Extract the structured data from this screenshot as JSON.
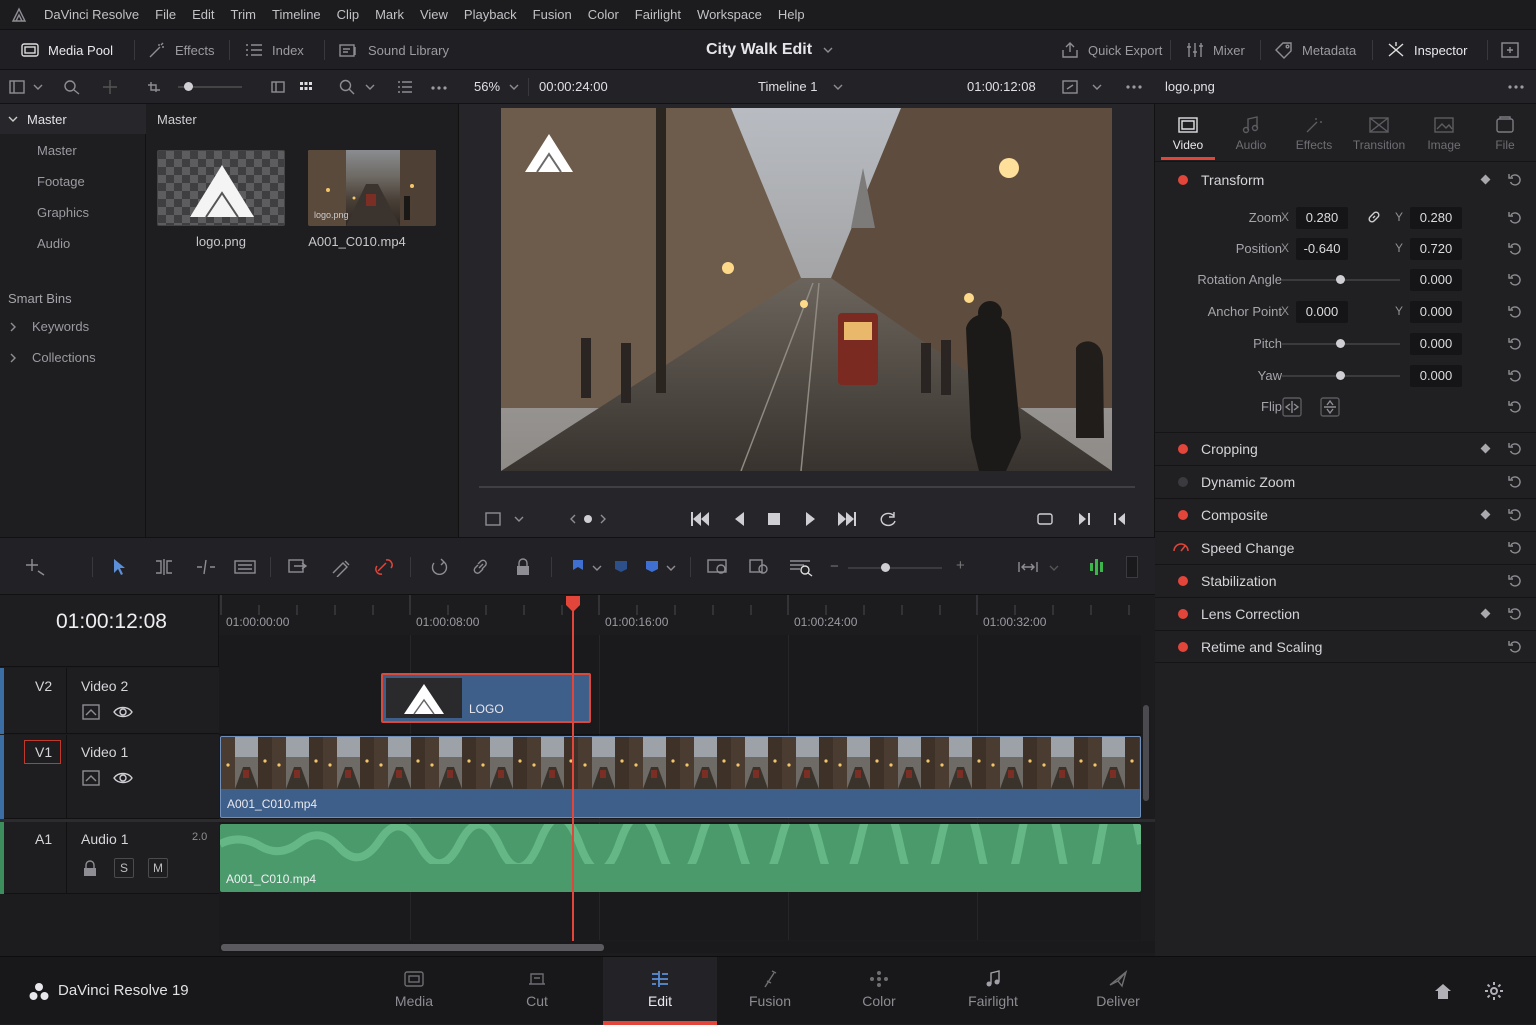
{
  "menubar": {
    "app_name": "DaVinci Resolve",
    "items": [
      "File",
      "Edit",
      "Trim",
      "Timeline",
      "Clip",
      "Mark",
      "View",
      "Playback",
      "Fusion",
      "Color",
      "Fairlight",
      "Workspace",
      "Help"
    ]
  },
  "toolbar": {
    "media_pool": "Media Pool",
    "effects": "Effects",
    "index": "Index",
    "sound_library": "Sound Library",
    "project_title": "City Walk Edit",
    "quick_export": "Quick Export",
    "mixer": "Mixer",
    "metadata": "Metadata",
    "inspector": "Inspector"
  },
  "media_pool": {
    "tree_root": "Master",
    "bins": [
      "Master",
      "Footage",
      "Graphics",
      "Audio"
    ],
    "smart_bins_label": "Smart Bins",
    "smart_bins": [
      "Keywords",
      "Collections"
    ],
    "panel_title": "Master",
    "clips": [
      {
        "name": "logo.png"
      },
      {
        "name": "A001_C010.mp4",
        "thumb_label": "logo.png"
      }
    ]
  },
  "viewer": {
    "zoom": "56%",
    "source_timecode": "00:00:24:00",
    "timeline_name": "Timeline 1",
    "current_timecode": "01:00:12:08"
  },
  "inspector": {
    "clip_name": "logo.png",
    "tabs": [
      "Video",
      "Audio",
      "Effects",
      "Transition",
      "Image",
      "File"
    ],
    "active_tab": "Video",
    "transform_title": "Transform",
    "zoom_label": "Zoom",
    "zoom_x": "0.280",
    "zoom_y": "0.280",
    "position_label": "Position",
    "position_x": "-0.640",
    "position_y": "0.720",
    "rotation_label": "Rotation Angle",
    "rotation": "0.000",
    "anchor_label": "Anchor Point",
    "anchor_x": "0.000",
    "anchor_y": "0.000",
    "pitch_label": "Pitch",
    "pitch": "0.000",
    "yaw_label": "Yaw",
    "yaw": "0.000",
    "flip_label": "Flip",
    "axis_x": "X",
    "axis_y": "Y",
    "sections": [
      "Cropping",
      "Dynamic Zoom",
      "Composite",
      "Speed Change",
      "Stabilization",
      "Lens Correction",
      "Retime and Scaling"
    ]
  },
  "timeline": {
    "timecode": "01:00:12:08",
    "ruler": [
      "01:00:00:00",
      "01:00:08:00",
      "01:00:16:00",
      "01:00:24:00",
      "01:00:32:00"
    ],
    "tracks": [
      {
        "id": "V2",
        "name": "Video 2"
      },
      {
        "id": "V1",
        "name": "Video 1"
      },
      {
        "id": "A1",
        "name": "Audio 1",
        "channels": "2.0",
        "solo": "S",
        "mute": "M"
      }
    ],
    "logo_clip": "LOGO",
    "video_clip": "A001_C010.mp4",
    "audio_clip": "A001_C010.mp4"
  },
  "pagebar": {
    "brand": "DaVinci Resolve 19",
    "pages": [
      "Media",
      "Cut",
      "Edit",
      "Fusion",
      "Color",
      "Fairlight",
      "Deliver"
    ],
    "active": "Edit"
  },
  "colors": {
    "accent_red": "#e2453a",
    "video_clip": "#3e5f8a",
    "audio_clip": "#4a9a6c"
  }
}
